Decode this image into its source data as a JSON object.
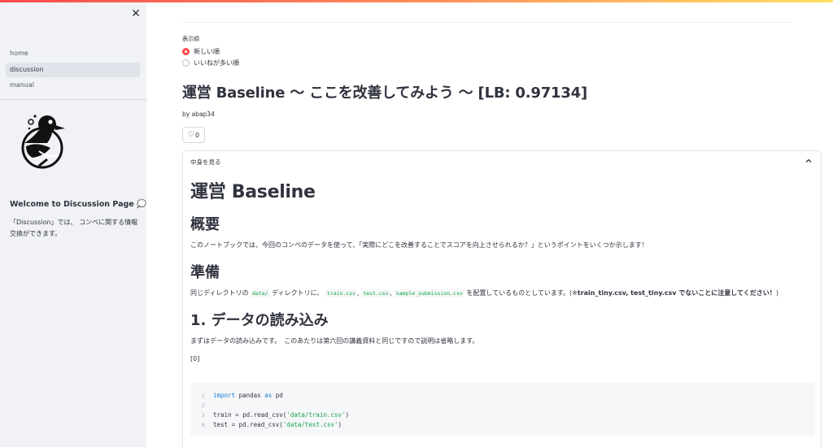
{
  "sidebar": {
    "close_glyph": "✕",
    "nav": [
      {
        "label": "home"
      },
      {
        "label": "discussion",
        "active": true
      },
      {
        "label": "manual"
      }
    ],
    "welcome_title": "Welcome to Discussion Page 💭",
    "welcome_text": "「Discussion」では、 コンペに関する情報交換ができます。"
  },
  "sort": {
    "label": "表示順",
    "options": [
      {
        "label": "新しい順",
        "selected": true
      },
      {
        "label": "いいねが多い順",
        "selected": false
      }
    ]
  },
  "post": {
    "title": "運営 Baseline 〜 ここを改善してみよう 〜 [LB: 0.97134]",
    "author": "by abap34",
    "likes": "0",
    "expander_label": "中身を見る"
  },
  "content": {
    "h1": "運営 Baseline",
    "section1_title": "概要",
    "section1_text": "このノートブックでは、今回のコンペのデータを使って、「実際にどこを改善することでスコアを向上させられるか？」というポイントをいくつか示します！",
    "section2_title": "準備",
    "section2_pre": "同じディレクトリの",
    "section2_code1": "data/",
    "section2_mid1": "ディレクトリに、",
    "section2_code2": "train.csv",
    "section2_sep1": ",",
    "section2_code3": "test.csv",
    "section2_sep2": ",",
    "section2_code4": "sample_submission.csv",
    "section2_post": "を配置しているものとしています。(※",
    "section2_bold": "train_tiny.csv, test_tiny.csv でないことに注意してください！",
    "section2_end": ")",
    "section3_title": "1. データの読み込み",
    "section3_text": "まずはデータの読み込みです。　このあたりは第六回の講義資料と同じですので説明は省略します。",
    "cell_label": "[0]",
    "code": [
      {
        "n": "1",
        "kw1": "import",
        "t1": " pandas ",
        "kw2": "as",
        "t2": " pd"
      },
      {
        "n": "2"
      },
      {
        "n": "3",
        "t1": "train = pd.read_csv(",
        "s": "'data/train.csv'",
        "t2": ")"
      },
      {
        "n": "4",
        "t1": "test = pd.read_csv(",
        "s": "'data/test.csv'",
        "t2": ")"
      }
    ]
  }
}
